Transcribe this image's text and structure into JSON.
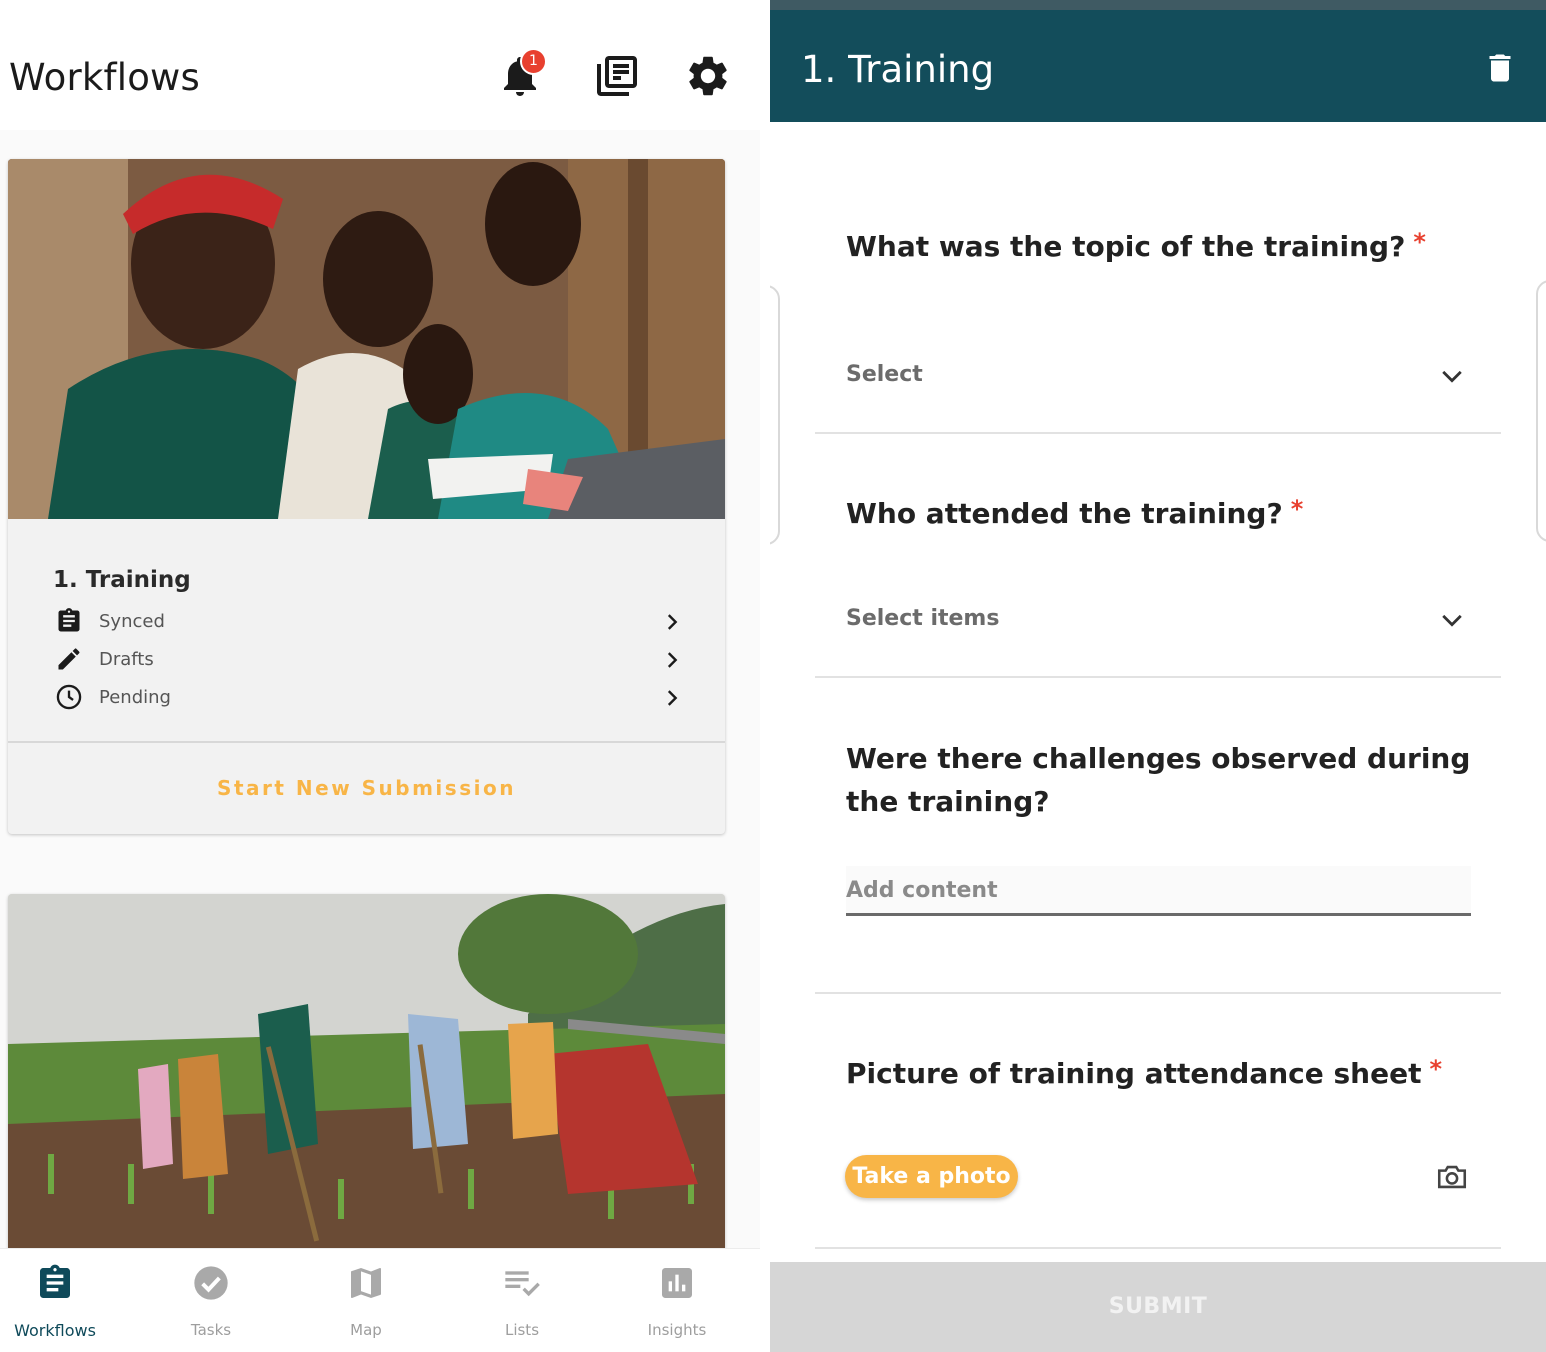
{
  "left": {
    "app_title": "Workflows",
    "notifications": {
      "count": "1",
      "icon": "bell-icon"
    },
    "header_icons": [
      "bell-icon",
      "library-icon",
      "gear-icon"
    ],
    "workflow_card": {
      "title": "1. Training",
      "rows": [
        {
          "label": "Synced",
          "icon": "clipboard-icon"
        },
        {
          "label": "Drafts",
          "icon": "pencil-icon"
        },
        {
          "label": "Pending",
          "icon": "clock-icon"
        }
      ],
      "action_label": "Start New Submission",
      "action_color": "#f8b547"
    },
    "bottom_nav": [
      {
        "label": "Workflows",
        "icon": "clipboard-icon",
        "active": true
      },
      {
        "label": "Tasks",
        "icon": "check-circle-icon",
        "active": false
      },
      {
        "label": "Map",
        "icon": "map-icon",
        "active": false
      },
      {
        "label": "Lists",
        "icon": "list-check-icon",
        "active": false
      },
      {
        "label": "Insights",
        "icon": "bar-chart-icon",
        "active": false
      }
    ]
  },
  "right": {
    "header_title": "1. Training",
    "header_color": "#134d5b",
    "questions": [
      {
        "text": "What was the topic of the training?",
        "required": "*",
        "select_label": "Select"
      },
      {
        "text": "Who attended the training?",
        "required": "*",
        "select_label": "Select items"
      },
      {
        "text": "Were there challenges observed during the training?",
        "placeholder": "Add content"
      },
      {
        "text": "Picture of training attendance sheet",
        "required": "*",
        "button_label": "Take a photo"
      }
    ],
    "submit_label": "SUBMIT"
  }
}
